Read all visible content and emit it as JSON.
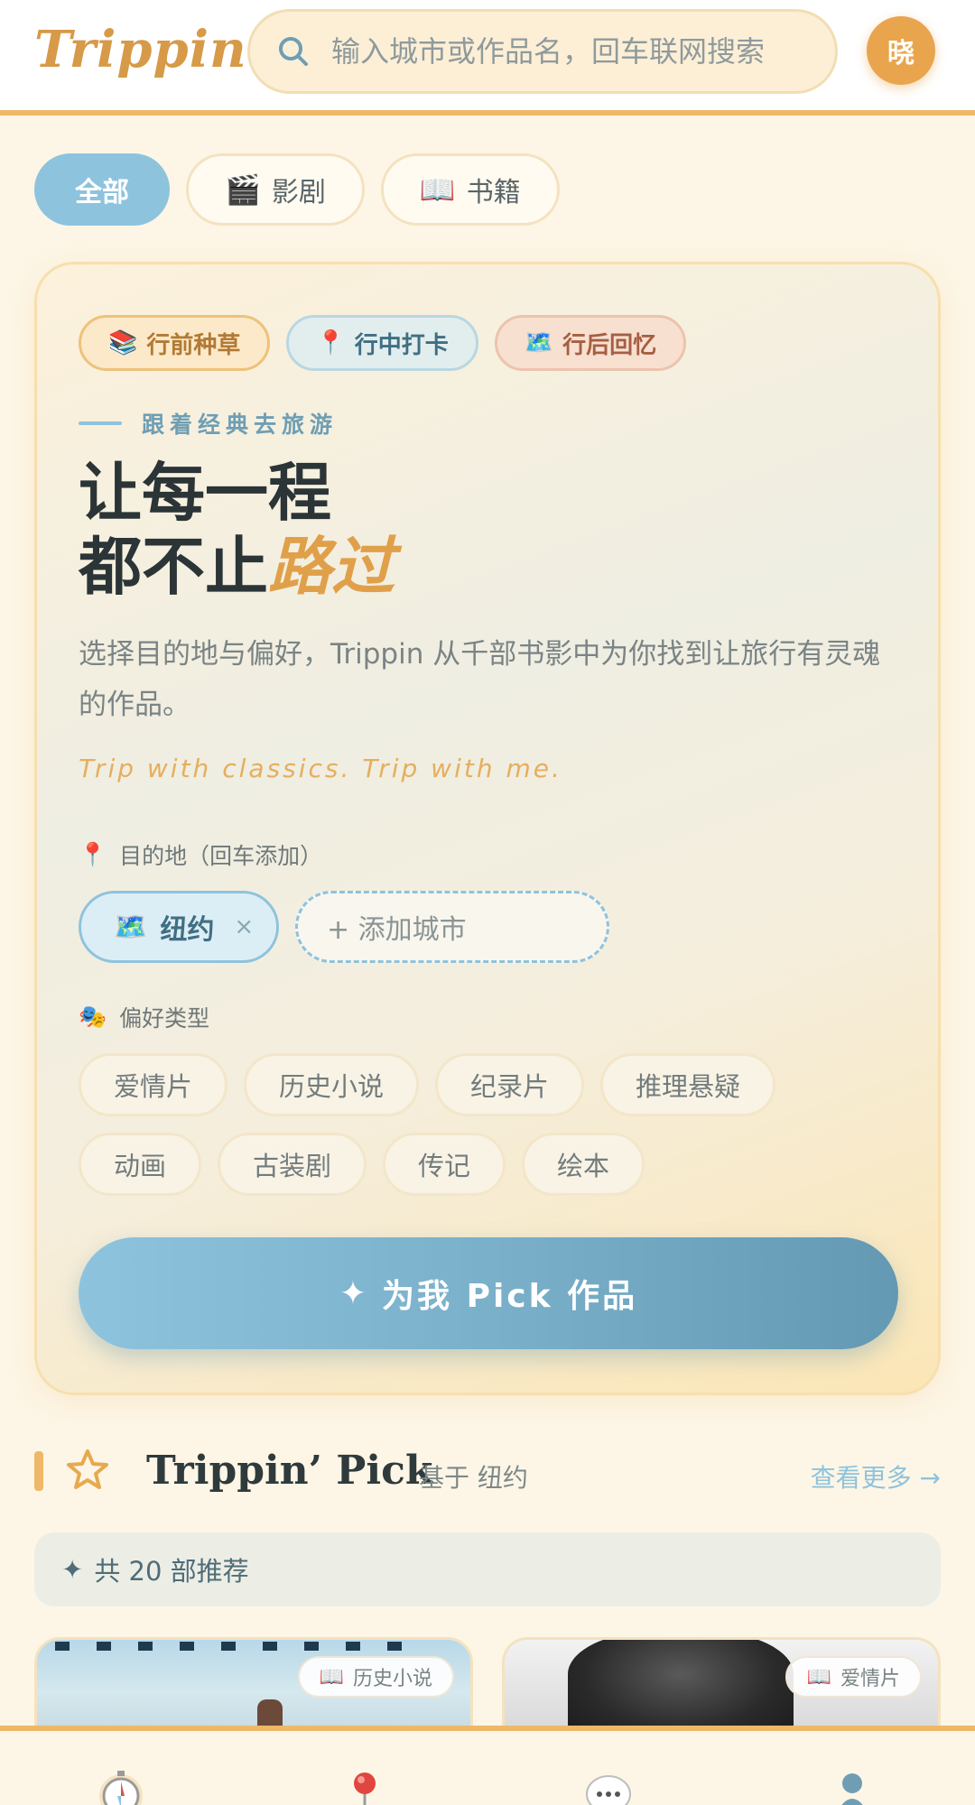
{
  "header": {
    "logo": "Trippin",
    "search_placeholder": "输入城市或作品名，回车联网搜索",
    "avatar_text": "晓"
  },
  "tabs": [
    {
      "label": "全部",
      "icon": "",
      "active": true
    },
    {
      "label": "影剧",
      "icon": "🎬",
      "active": false
    },
    {
      "label": "书籍",
      "icon": "📖",
      "active": false
    }
  ],
  "hero": {
    "stages": [
      {
        "icon": "📚",
        "label": "行前种草"
      },
      {
        "icon": "📍",
        "label": "行中打卡"
      },
      {
        "icon": "🗺️",
        "label": "行后回忆"
      }
    ],
    "eyebrow": "跟着经典去旅游",
    "headline_line1": "让每一程",
    "headline_line2_prefix": "都不止",
    "headline_line2_accent": "路过",
    "description": "选择目的地与偏好，Trippin 从千部书影中为你找到让旅行有灵魂的作品。",
    "tagline": "Trip with classics. Trip with me.",
    "destination_label": "目的地（回车添加）",
    "destination_icon": "📍",
    "cities": [
      {
        "icon": "🗺️",
        "name": "纽约",
        "remove": "×"
      }
    ],
    "add_city_placeholder": "+ 添加城市",
    "preference_label": "偏好类型",
    "preference_icon": "🎭",
    "preferences": [
      "爱情片",
      "历史小说",
      "纪录片",
      "推理悬疑",
      "动画",
      "古装剧",
      "传记",
      "绘本"
    ],
    "cta_icon": "✦",
    "cta_label": "为我 Pick 作品"
  },
  "pick_section": {
    "title": "Trippin’ Pick",
    "subtitle": "基于 纽约",
    "more_link": "查看更多 →",
    "count_icon": "✦",
    "count_text": "共 20 部推荐",
    "cards": [
      {
        "tag_icon": "📖",
        "tag": "历史小说"
      },
      {
        "tag_icon": "📖",
        "tag": "爱情片"
      }
    ]
  },
  "bottom_nav": [
    {
      "icon": "compass-icon"
    },
    {
      "icon": "map-pin-icon"
    },
    {
      "icon": "chat-bubble-icon"
    },
    {
      "icon": "profile-icon"
    }
  ],
  "colors": {
    "accent_gold": "#EDB968",
    "accent_blue": "#8EC3DD",
    "background": "#FDF6E6"
  }
}
